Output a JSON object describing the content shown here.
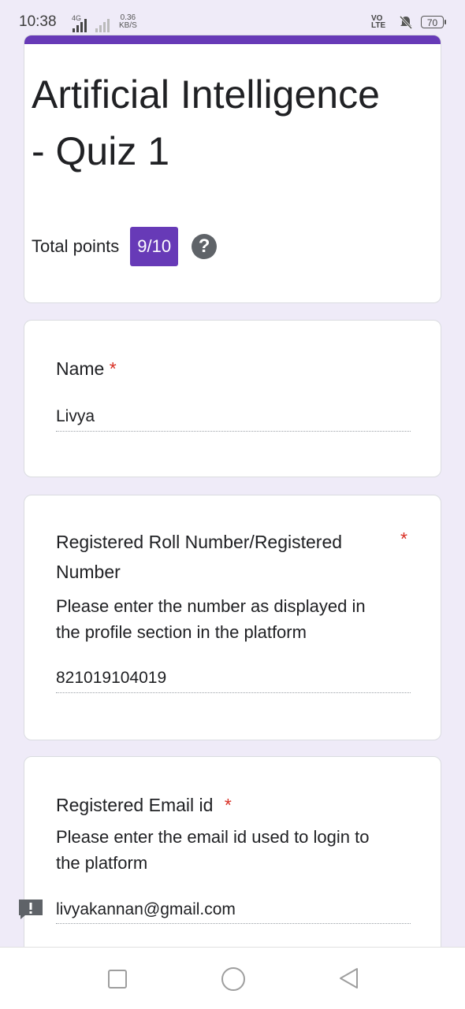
{
  "status_bar": {
    "time": "10:38",
    "network": "4G",
    "data_speed_value": "0.36",
    "data_speed_unit": "KB/S",
    "volte_top": "VO",
    "volte_bottom": "LTE",
    "battery": "70"
  },
  "form": {
    "accent_color": "#673ab7",
    "title": "Artificial Intelligence - Quiz 1",
    "total_points_label": "Total points",
    "score": "9/10",
    "help_icon": "?"
  },
  "questions": [
    {
      "title": "Name",
      "required_mark": "*",
      "help_text": "",
      "answer": "Livya"
    },
    {
      "title_line1": "Registered Roll Number/Registered",
      "title_line2": "Number",
      "required_mark": "*",
      "help_line1": "Please enter the number as displayed in",
      "help_line2": "the profile section in the platform",
      "answer": "821019104019"
    },
    {
      "title": "Registered Email id",
      "required_mark": "*",
      "help_line1": "Please enter the email id used to login to",
      "help_line2": "the platform",
      "answer": "livyakannan@gmail.com"
    }
  ],
  "icons": {
    "warning": "exclamation-icon",
    "help": "question-icon",
    "mute": "mute-icon",
    "nav_recents": "square-icon",
    "nav_home": "circle-icon",
    "nav_back": "triangle-back-icon"
  }
}
